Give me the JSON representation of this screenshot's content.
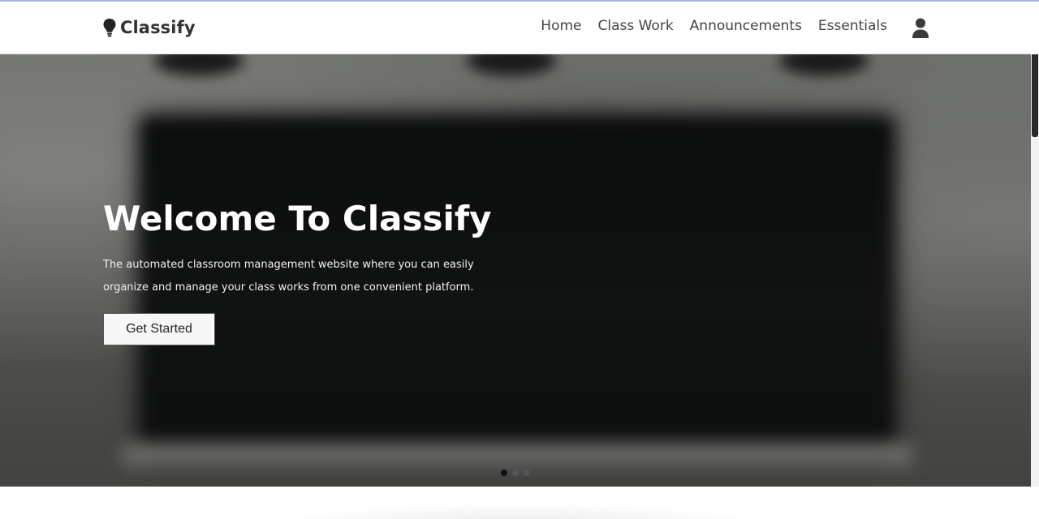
{
  "navbar": {
    "brand": {
      "icon": "lightbulb-icon",
      "name": "Classify"
    },
    "links": [
      {
        "label": "Home"
      },
      {
        "label": "Class Work"
      },
      {
        "label": "Announcements"
      },
      {
        "label": "Essentials"
      }
    ],
    "user_icon": "user-icon"
  },
  "hero": {
    "title": "Welcome To Classify",
    "subtitle_line1": "The automated classroom management website where you can easily",
    "subtitle_line2": "organize and manage your class works from one convenient platform.",
    "cta_label": "Get Started",
    "slides": {
      "count": 3,
      "active_index": 0
    }
  },
  "colors": {
    "accent_top_border": "#aab1e3",
    "text_dark": "#333333",
    "cta_bg": "#f7f7f7"
  }
}
